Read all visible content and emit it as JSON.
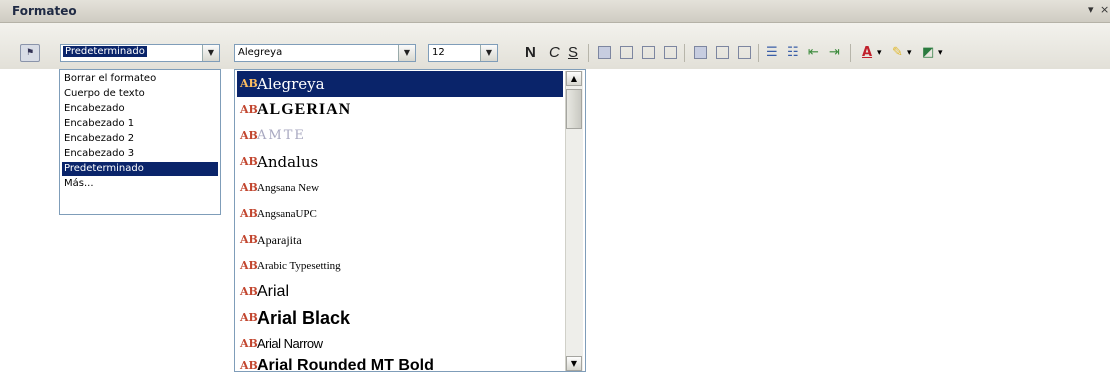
{
  "panel": {
    "title": "Formateo",
    "controls": [
      "▾",
      "×"
    ]
  },
  "toolbar": {
    "paragraph_style": "Predeterminado",
    "font_name": "Alegreya",
    "font_size": "12",
    "bold_label": "N",
    "italic_label": "C",
    "underline_label": "S"
  },
  "style_dropdown": {
    "items": [
      {
        "label": "Borrar el formateo",
        "selected": false
      },
      {
        "label": "Cuerpo de texto",
        "selected": false
      },
      {
        "label": "Encabezado",
        "selected": false
      },
      {
        "label": "Encabezado 1",
        "selected": false
      },
      {
        "label": "Encabezado 2",
        "selected": false
      },
      {
        "label": "Encabezado 3",
        "selected": false
      },
      {
        "label": "Predeterminado",
        "selected": true
      },
      {
        "label": "Más...",
        "selected": false
      }
    ]
  },
  "font_dropdown": {
    "items": [
      {
        "label": "Alegreya",
        "selected": true
      },
      {
        "label": "ALGERIAN",
        "selected": false
      },
      {
        "label": "AMTE",
        "selected": false
      },
      {
        "label": "Andalus",
        "selected": false
      },
      {
        "label": "Angsana New",
        "selected": false
      },
      {
        "label": "AngsanaUPC",
        "selected": false
      },
      {
        "label": "Aparajita",
        "selected": false
      },
      {
        "label": "Arabic Typesetting",
        "selected": false
      },
      {
        "label": "Arial",
        "selected": false
      },
      {
        "label": "Arial Black",
        "selected": false
      },
      {
        "label": "Arial Narrow",
        "selected": false
      },
      {
        "label": "Arial Rounded MT Bold",
        "selected": false
      }
    ],
    "item_icon": "AB",
    "colors": {
      "icon": "#c2462f",
      "selection": "#0a246a"
    }
  }
}
